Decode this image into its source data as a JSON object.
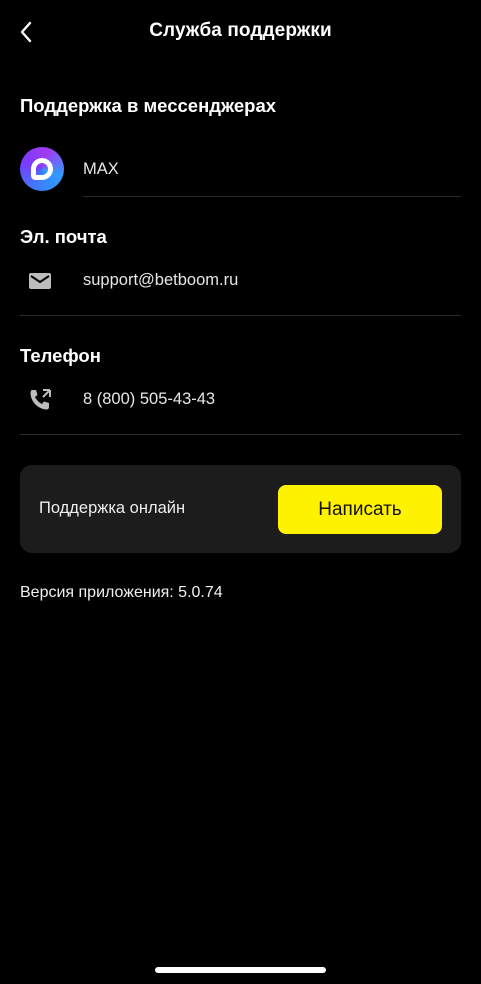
{
  "header": {
    "title": "Служба поддержки",
    "back_icon": "chevron-left-icon"
  },
  "messengers": {
    "heading": "Поддержка в мессенджерах",
    "items": [
      {
        "label": "MAX",
        "icon": "max-logo-icon"
      }
    ]
  },
  "email": {
    "heading": "Эл. почта",
    "value": "support@betboom.ru",
    "icon": "mail-icon"
  },
  "phone": {
    "heading": "Телефон",
    "value": "8 (800) 505-43-43",
    "icon": "phone-icon"
  },
  "online_support": {
    "label": "Поддержка онлайн",
    "button_label": "Написать",
    "button_color": "#fff200",
    "card_color": "#1c1c1c"
  },
  "footer": {
    "version_text": "Версия приложения: 5.0.74"
  }
}
